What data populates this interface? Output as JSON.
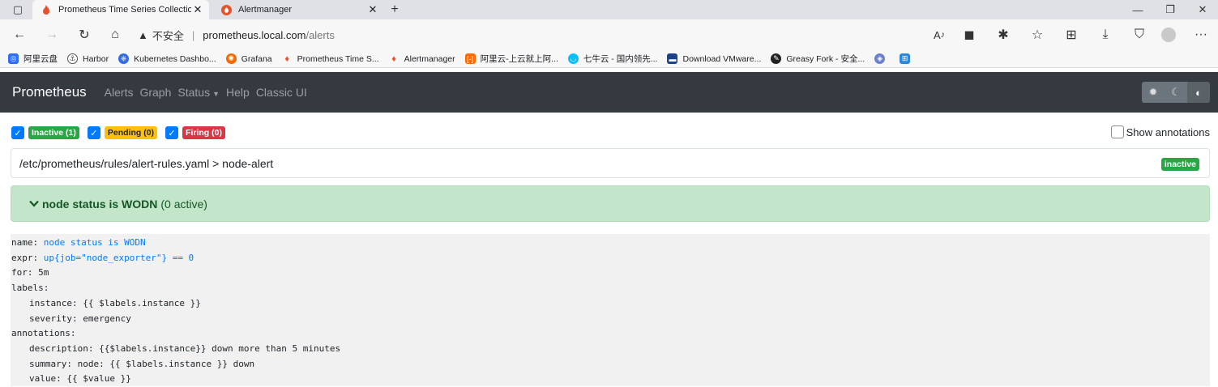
{
  "browser": {
    "tabs": [
      {
        "title": "Prometheus Time Series Collectio",
        "active": true
      },
      {
        "title": "Alertmanager",
        "active": false
      }
    ],
    "address": {
      "security_text": "不安全",
      "host": "prometheus.local.com",
      "path": "/alerts"
    },
    "bookmarks": [
      {
        "label": "阿里云盘",
        "icon": "aliyun-drive-icon",
        "color": "#2f6df6"
      },
      {
        "label": "Harbor",
        "icon": "harbor-icon",
        "color": "#555555"
      },
      {
        "label": "Kubernetes Dashbo...",
        "icon": "kubernetes-icon",
        "color": "#326ce5"
      },
      {
        "label": "Grafana",
        "icon": "grafana-icon",
        "color": "#f46800"
      },
      {
        "label": "Prometheus Time S...",
        "icon": "prometheus-icon",
        "color": "#e6522c"
      },
      {
        "label": "Alertmanager",
        "icon": "alertmanager-icon",
        "color": "#e6522c"
      },
      {
        "label": "阿里云-上云就上阿...",
        "icon": "aliyun-icon",
        "color": "#ff6a00"
      },
      {
        "label": "七牛云 - 国内领先...",
        "icon": "qiniu-icon",
        "color": "#07beff"
      },
      {
        "label": "Download VMware...",
        "icon": "vmware-icon",
        "color": "#1d428a"
      },
      {
        "label": "Greasy Fork - 安全...",
        "icon": "greasyfork-icon",
        "color": "#222222"
      }
    ]
  },
  "prometheus": {
    "brand": "Prometheus",
    "nav": [
      "Alerts",
      "Graph",
      "Status",
      "Help",
      "Classic UI"
    ],
    "filters": [
      {
        "label": "Inactive (1)",
        "color": "#28a745"
      },
      {
        "label": "Pending (0)",
        "color": "#ffc107"
      },
      {
        "label": "Firing (0)",
        "color": "#dc3545"
      }
    ],
    "show_annotations_label": "Show annotations",
    "group": {
      "path": "/etc/prometheus/rules/alert-rules.yaml > node-alert",
      "state": "inactive"
    },
    "alert": {
      "name": "node status is WODN",
      "active_text": "(0 active)"
    },
    "rule": {
      "name_key": "name:",
      "name_val": "node status is WODN",
      "expr_key": "expr:",
      "expr_val": "up{job=\"node_exporter\"} == 0",
      "for_line": "for: 5m",
      "labels_key": "labels:",
      "label_instance": "instance: {{ $labels.instance }}",
      "label_severity": "severity: emergency",
      "annotations_key": "annotations:",
      "ann_description": "description: {{$labels.instance}} down more than 5 minutes",
      "ann_summary": "summary: node: {{ $labels.instance }} down",
      "ann_value": "value: {{ $value }}"
    }
  }
}
